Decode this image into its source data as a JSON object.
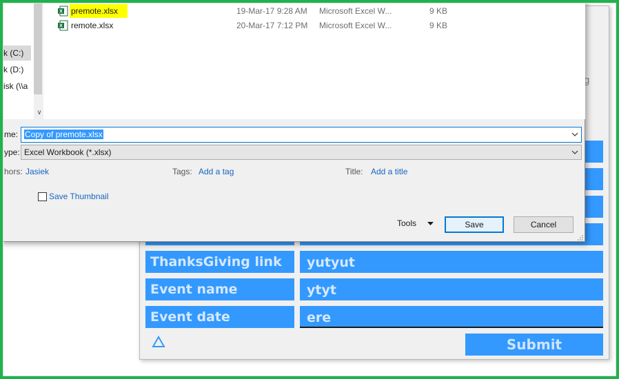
{
  "form": {
    "side_text": "g",
    "rows": [
      {
        "label": "ThanksGiving link",
        "value": "yutyut"
      },
      {
        "label": "Event name",
        "value": "ytyt"
      },
      {
        "label": "Event date",
        "value": "ere"
      }
    ],
    "submit_label": "Submit"
  },
  "dialog": {
    "nav_items": [
      "k (C:)",
      "k (D:)",
      "isk (\\\\a"
    ],
    "files": [
      {
        "name": "premote.xlsx",
        "date": "19-Mar-17 9:28 AM",
        "type": "Microsoft Excel W...",
        "size": "9 KB"
      },
      {
        "name": "remote.xlsx",
        "date": "20-Mar-17 7:12 PM",
        "type": "Microsoft Excel W...",
        "size": "9 KB"
      }
    ],
    "filename_label": "me:",
    "filename_value": "Copy of premote.xlsx",
    "filetype_label": "ype:",
    "filetype_value": "Excel Workbook (*.xlsx)",
    "authors_label": "hors:",
    "authors_value": "Jasiek",
    "tags_label": "Tags:",
    "tags_value": "Add a tag",
    "title_label": "Title:",
    "title_value": "Add a title",
    "thumbnail_label": "Save Thumbnail",
    "tools_label": "Tools",
    "save_label": "Save",
    "cancel_label": "Cancel"
  },
  "colors": {
    "frame": "#22b14c",
    "form_blue": "#3399ff",
    "highlight": "#ffff00",
    "link": "#1565c0",
    "focus": "#0078d7"
  },
  "icons": {
    "file": "excel-file-icon",
    "dropdown": "chevron-down-icon",
    "tools_caret": "caret-down-icon",
    "form_logo": "triangle-icon",
    "grip": "resize-grip-icon"
  }
}
